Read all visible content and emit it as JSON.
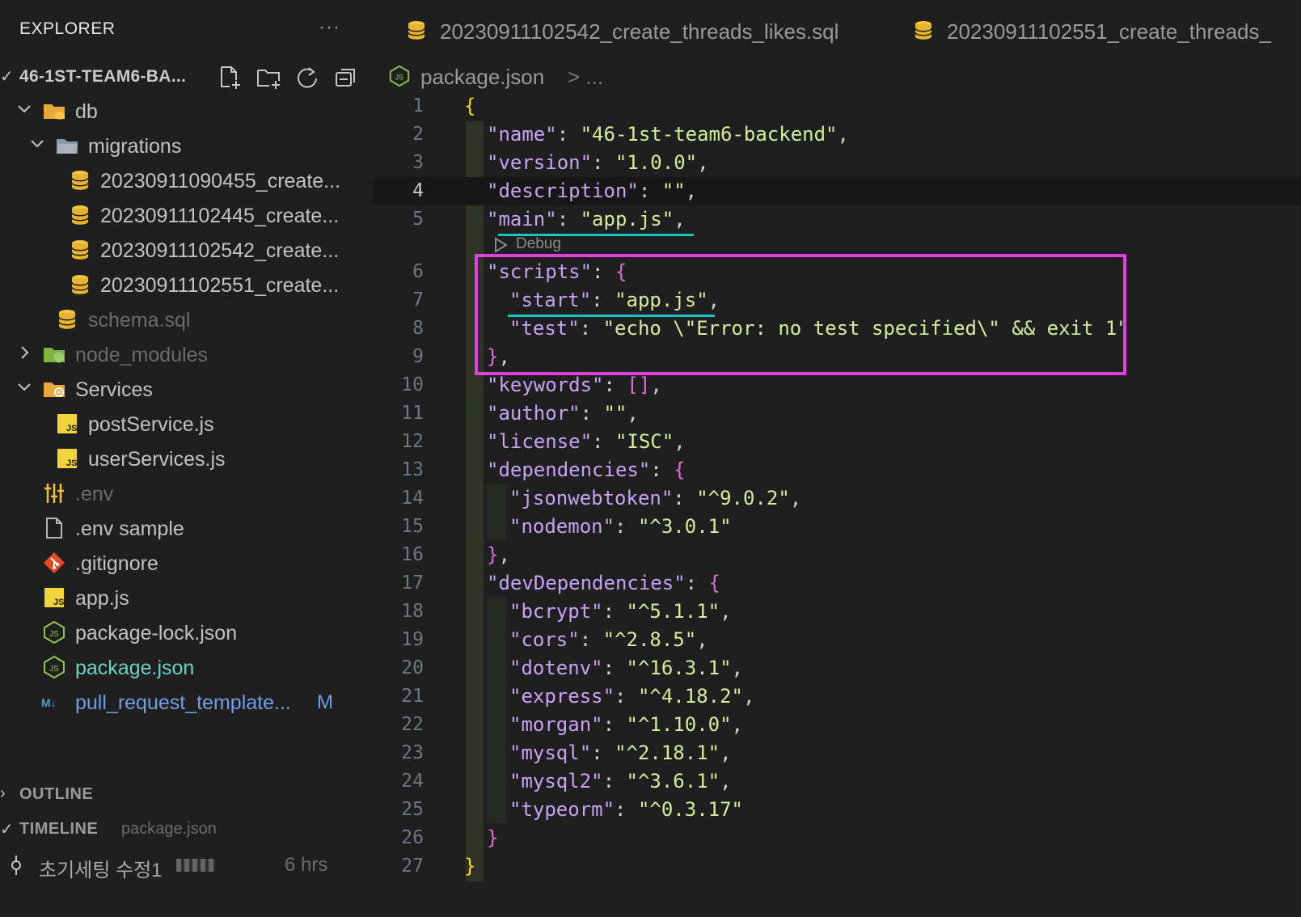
{
  "sidebar": {
    "header": "EXPLORER",
    "more": "···",
    "root_label": "46-1ST-TEAM6-BA...",
    "tree": [
      {
        "label": "db",
        "icon": "folder-db-icon"
      },
      {
        "label": "migrations",
        "icon": "folder-open-icon"
      },
      {
        "label": "20230911090455_create...",
        "icon": "database-icon"
      },
      {
        "label": "20230911102445_create...",
        "icon": "database-icon"
      },
      {
        "label": "20230911102542_create...",
        "icon": "database-icon"
      },
      {
        "label": "20230911102551_create...",
        "icon": "database-icon"
      },
      {
        "label": "schema.sql",
        "icon": "database-icon"
      },
      {
        "label": "node_modules",
        "icon": "folder-node-icon"
      },
      {
        "label": "Services",
        "icon": "folder-services-icon"
      },
      {
        "label": "postService.js",
        "icon": "js-file-icon"
      },
      {
        "label": "userServices.js",
        "icon": "js-file-icon"
      },
      {
        "label": ".env",
        "icon": "env-settings-icon"
      },
      {
        "label": ".env sample",
        "icon": "file-icon"
      },
      {
        "label": ".gitignore",
        "icon": "git-icon"
      },
      {
        "label": "app.js",
        "icon": "js-file-icon"
      },
      {
        "label": "package-lock.json",
        "icon": "nodejs-icon"
      },
      {
        "label": "package.json",
        "icon": "nodejs-icon"
      },
      {
        "label": "pull_request_template...",
        "icon": "markdown-icon",
        "badge": "M"
      }
    ],
    "outline": "OUTLINE",
    "timeline": "TIMELINE",
    "timeline_file": "package.json",
    "timeline_entry": {
      "message": "초기세팅 수정1",
      "time": "6 hrs"
    }
  },
  "editor": {
    "tabs": [
      {
        "label": "20230911102542_create_threads_likes.sql"
      },
      {
        "label": "20230911102551_create_threads_"
      }
    ],
    "breadcrumb": {
      "file": "package.json",
      "separator": "> ..."
    },
    "codelens": "Debug",
    "lines": [
      {
        "n": "1"
      },
      {
        "n": "2"
      },
      {
        "n": "3"
      },
      {
        "n": "4"
      },
      {
        "n": "5"
      },
      {
        "n": "6"
      },
      {
        "n": "7"
      },
      {
        "n": "8"
      },
      {
        "n": "9"
      },
      {
        "n": "10"
      },
      {
        "n": "11"
      },
      {
        "n": "12"
      },
      {
        "n": "13"
      },
      {
        "n": "14"
      },
      {
        "n": "15"
      },
      {
        "n": "16"
      },
      {
        "n": "17"
      },
      {
        "n": "18"
      },
      {
        "n": "19"
      },
      {
        "n": "20"
      },
      {
        "n": "21"
      },
      {
        "n": "22"
      },
      {
        "n": "23"
      },
      {
        "n": "24"
      },
      {
        "n": "25"
      },
      {
        "n": "26"
      },
      {
        "n": "27"
      }
    ],
    "code": {
      "l1": "{",
      "name_key": "\"name\"",
      "name_val": "\"46-1st-team6-backend\"",
      "version_key": "\"version\"",
      "version_val": "\"1.0.0\"",
      "description_key": "\"description\"",
      "description_val": "\"\"",
      "main_key": "\"main\"",
      "main_val": "\"app.js\"",
      "scripts_key": "\"scripts\"",
      "start_key": "\"start\"",
      "start_val": "\"app.js\"",
      "test_key": "\"test\"",
      "test_val": "\"echo \\\"Error: no test specified\\\" && exit 1\"",
      "keywords_key": "\"keywords\"",
      "keywords_val": "[]",
      "author_key": "\"author\"",
      "author_val": "\"\"",
      "license_key": "\"license\"",
      "license_val": "\"ISC\"",
      "dependencies_key": "\"dependencies\"",
      "jwt_key": "\"jsonwebtoken\"",
      "jwt_val": "\"^9.0.2\"",
      "nodemon_key": "\"nodemon\"",
      "nodemon_val": "\"^3.0.1\"",
      "devdeps_key": "\"devDependencies\"",
      "bcrypt_key": "\"bcrypt\"",
      "bcrypt_val": "\"^5.1.1\"",
      "cors_key": "\"cors\"",
      "cors_val": "\"^2.8.5\"",
      "dotenv_key": "\"dotenv\"",
      "dotenv_val": "\"^16.3.1\"",
      "express_key": "\"express\"",
      "express_val": "\"^4.18.2\"",
      "morgan_key": "\"morgan\"",
      "morgan_val": "\"^1.10.0\"",
      "mysql_key": "\"mysql\"",
      "mysql_val": "\"^2.18.1\"",
      "mysql2_key": "\"mysql2\"",
      "mysql2_val": "\"^3.6.1\"",
      "typeorm_key": "\"typeorm\"",
      "typeorm_val": "\"^0.3.17\"",
      "l27": "}"
    }
  },
  "colors": {
    "highlight_box": "#e040e0",
    "underline": "#15c4c4",
    "json_key": "#c8a2f5",
    "json_value": "#d7ec9a",
    "bracket_gold": "#ffd700",
    "bracket_magenta": "#da70d6"
  }
}
